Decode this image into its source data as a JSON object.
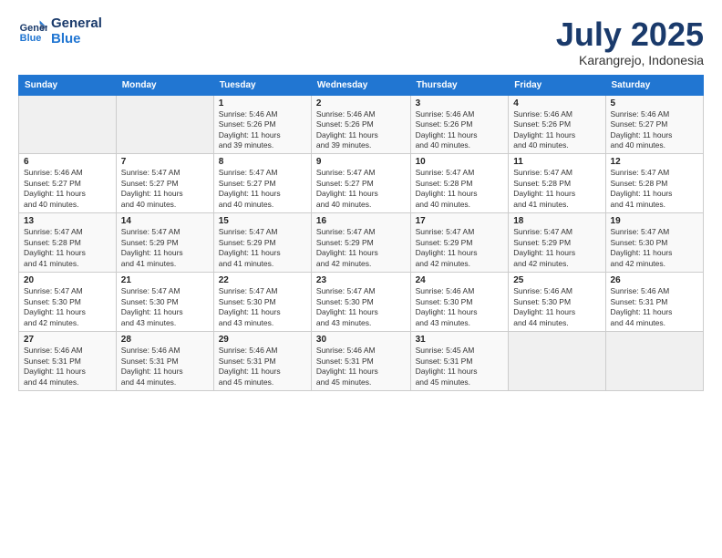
{
  "logo": {
    "line1": "General",
    "line2": "Blue"
  },
  "title": "July 2025",
  "subtitle": "Karangrejo, Indonesia",
  "days_header": [
    "Sunday",
    "Monday",
    "Tuesday",
    "Wednesday",
    "Thursday",
    "Friday",
    "Saturday"
  ],
  "weeks": [
    [
      {
        "num": "",
        "detail": ""
      },
      {
        "num": "",
        "detail": ""
      },
      {
        "num": "1",
        "detail": "Sunrise: 5:46 AM\nSunset: 5:26 PM\nDaylight: 11 hours\nand 39 minutes."
      },
      {
        "num": "2",
        "detail": "Sunrise: 5:46 AM\nSunset: 5:26 PM\nDaylight: 11 hours\nand 39 minutes."
      },
      {
        "num": "3",
        "detail": "Sunrise: 5:46 AM\nSunset: 5:26 PM\nDaylight: 11 hours\nand 40 minutes."
      },
      {
        "num": "4",
        "detail": "Sunrise: 5:46 AM\nSunset: 5:26 PM\nDaylight: 11 hours\nand 40 minutes."
      },
      {
        "num": "5",
        "detail": "Sunrise: 5:46 AM\nSunset: 5:27 PM\nDaylight: 11 hours\nand 40 minutes."
      }
    ],
    [
      {
        "num": "6",
        "detail": "Sunrise: 5:46 AM\nSunset: 5:27 PM\nDaylight: 11 hours\nand 40 minutes."
      },
      {
        "num": "7",
        "detail": "Sunrise: 5:47 AM\nSunset: 5:27 PM\nDaylight: 11 hours\nand 40 minutes."
      },
      {
        "num": "8",
        "detail": "Sunrise: 5:47 AM\nSunset: 5:27 PM\nDaylight: 11 hours\nand 40 minutes."
      },
      {
        "num": "9",
        "detail": "Sunrise: 5:47 AM\nSunset: 5:27 PM\nDaylight: 11 hours\nand 40 minutes."
      },
      {
        "num": "10",
        "detail": "Sunrise: 5:47 AM\nSunset: 5:28 PM\nDaylight: 11 hours\nand 40 minutes."
      },
      {
        "num": "11",
        "detail": "Sunrise: 5:47 AM\nSunset: 5:28 PM\nDaylight: 11 hours\nand 41 minutes."
      },
      {
        "num": "12",
        "detail": "Sunrise: 5:47 AM\nSunset: 5:28 PM\nDaylight: 11 hours\nand 41 minutes."
      }
    ],
    [
      {
        "num": "13",
        "detail": "Sunrise: 5:47 AM\nSunset: 5:28 PM\nDaylight: 11 hours\nand 41 minutes."
      },
      {
        "num": "14",
        "detail": "Sunrise: 5:47 AM\nSunset: 5:29 PM\nDaylight: 11 hours\nand 41 minutes."
      },
      {
        "num": "15",
        "detail": "Sunrise: 5:47 AM\nSunset: 5:29 PM\nDaylight: 11 hours\nand 41 minutes."
      },
      {
        "num": "16",
        "detail": "Sunrise: 5:47 AM\nSunset: 5:29 PM\nDaylight: 11 hours\nand 42 minutes."
      },
      {
        "num": "17",
        "detail": "Sunrise: 5:47 AM\nSunset: 5:29 PM\nDaylight: 11 hours\nand 42 minutes."
      },
      {
        "num": "18",
        "detail": "Sunrise: 5:47 AM\nSunset: 5:29 PM\nDaylight: 11 hours\nand 42 minutes."
      },
      {
        "num": "19",
        "detail": "Sunrise: 5:47 AM\nSunset: 5:30 PM\nDaylight: 11 hours\nand 42 minutes."
      }
    ],
    [
      {
        "num": "20",
        "detail": "Sunrise: 5:47 AM\nSunset: 5:30 PM\nDaylight: 11 hours\nand 42 minutes."
      },
      {
        "num": "21",
        "detail": "Sunrise: 5:47 AM\nSunset: 5:30 PM\nDaylight: 11 hours\nand 43 minutes."
      },
      {
        "num": "22",
        "detail": "Sunrise: 5:47 AM\nSunset: 5:30 PM\nDaylight: 11 hours\nand 43 minutes."
      },
      {
        "num": "23",
        "detail": "Sunrise: 5:47 AM\nSunset: 5:30 PM\nDaylight: 11 hours\nand 43 minutes."
      },
      {
        "num": "24",
        "detail": "Sunrise: 5:46 AM\nSunset: 5:30 PM\nDaylight: 11 hours\nand 43 minutes."
      },
      {
        "num": "25",
        "detail": "Sunrise: 5:46 AM\nSunset: 5:30 PM\nDaylight: 11 hours\nand 44 minutes."
      },
      {
        "num": "26",
        "detail": "Sunrise: 5:46 AM\nSunset: 5:31 PM\nDaylight: 11 hours\nand 44 minutes."
      }
    ],
    [
      {
        "num": "27",
        "detail": "Sunrise: 5:46 AM\nSunset: 5:31 PM\nDaylight: 11 hours\nand 44 minutes."
      },
      {
        "num": "28",
        "detail": "Sunrise: 5:46 AM\nSunset: 5:31 PM\nDaylight: 11 hours\nand 44 minutes."
      },
      {
        "num": "29",
        "detail": "Sunrise: 5:46 AM\nSunset: 5:31 PM\nDaylight: 11 hours\nand 45 minutes."
      },
      {
        "num": "30",
        "detail": "Sunrise: 5:46 AM\nSunset: 5:31 PM\nDaylight: 11 hours\nand 45 minutes."
      },
      {
        "num": "31",
        "detail": "Sunrise: 5:45 AM\nSunset: 5:31 PM\nDaylight: 11 hours\nand 45 minutes."
      },
      {
        "num": "",
        "detail": ""
      },
      {
        "num": "",
        "detail": ""
      }
    ]
  ]
}
